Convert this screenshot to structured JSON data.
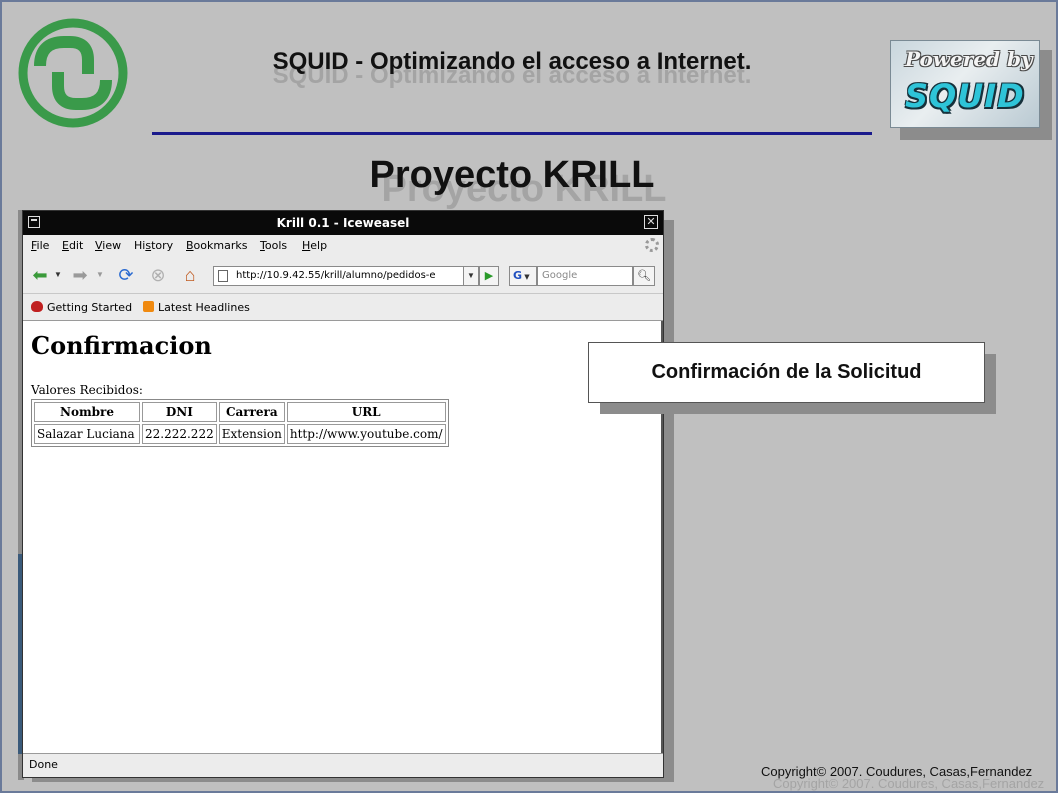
{
  "slide": {
    "title": "SQUID - Optimizando el acceso a Internet.",
    "subtitle": "Proyecto KRILL",
    "powered_by": "Powered by",
    "powered_brand": "SQUID",
    "callout": "Confirmación de la Solicitud",
    "copyright": "Copyright© 2007. Coudures, Casas,Fernandez"
  },
  "browser": {
    "window_title": "Krill 0.1 - Iceweasel",
    "menu": [
      {
        "key": "F",
        "rest": "ile"
      },
      {
        "key": "E",
        "rest": "dit"
      },
      {
        "key": "V",
        "rest": "iew"
      },
      {
        "pre": "Hi",
        "key": "s",
        "rest": "tory"
      },
      {
        "key": "B",
        "rest": "ookmarks"
      },
      {
        "key": "T",
        "rest": "ools"
      },
      {
        "key": "H",
        "rest": "elp"
      }
    ],
    "url": "http://10.9.42.55/krill/alumno/pedidos-e",
    "search_engine": "G",
    "search_placeholder": "Google",
    "bookmarks": [
      "Getting Started",
      "Latest Headlines"
    ],
    "status": "Done"
  },
  "page": {
    "heading": "Confirmacion",
    "received_label": "Valores Recibidos:",
    "table": {
      "headers": [
        "Nombre",
        "DNI",
        "Carrera",
        "URL"
      ],
      "rows": [
        [
          "Salazar Luciana",
          "22.222.222",
          "Extension",
          "http://www.youtube.com/"
        ]
      ]
    }
  },
  "colors": {
    "background": "#c0c0c0",
    "rule": "#1a1a8c",
    "logo_green": "#3a9a4a"
  }
}
